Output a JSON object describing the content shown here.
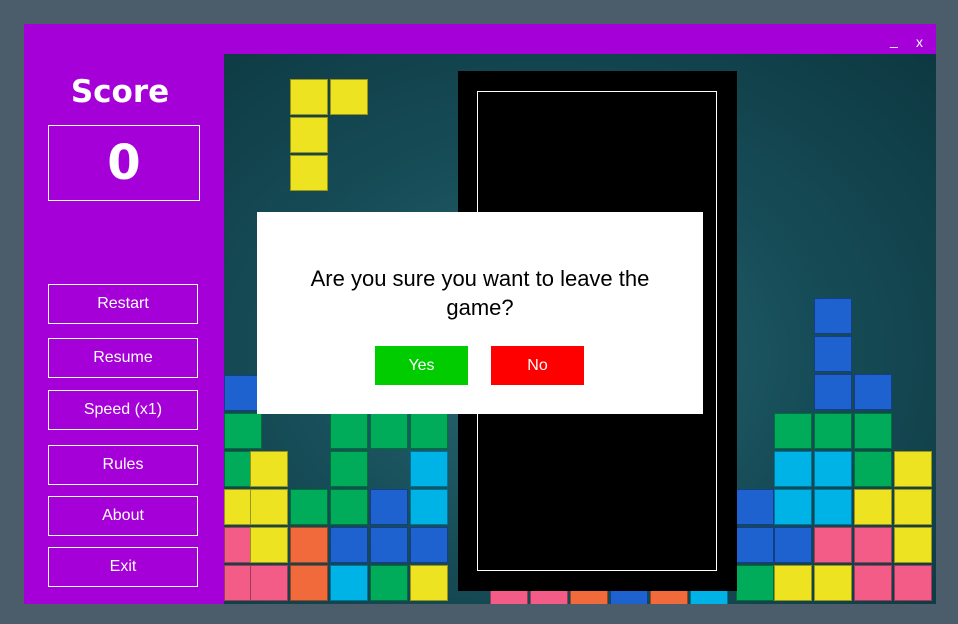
{
  "window": {
    "minimize_label": "_",
    "close_label": "x",
    "accent": "#a500d8"
  },
  "score": {
    "title": "Score",
    "value": "0"
  },
  "menu": {
    "items": [
      {
        "label": "Restart"
      },
      {
        "label": "Resume"
      },
      {
        "label": "Speed (x1)"
      },
      {
        "label": "Rules"
      },
      {
        "label": "About"
      },
      {
        "label": "Exit"
      }
    ]
  },
  "dialog": {
    "message": "Are you sure you want to leave the game?",
    "yes_label": "Yes",
    "no_label": "No",
    "yes_color": "#00cc00",
    "no_color": "#ff0000"
  },
  "colors": {
    "yellow": "#ede320",
    "green": "#00ab5a",
    "blue": "#1d62cf",
    "cyan": "#00b3e6",
    "pink": "#f25c86",
    "orange": "#f06a3b"
  }
}
